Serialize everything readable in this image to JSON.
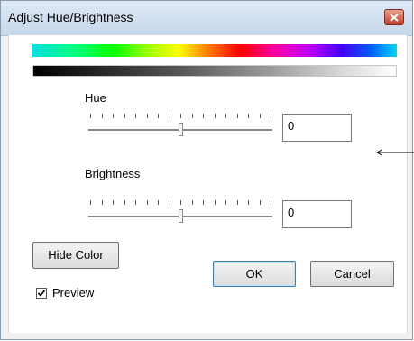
{
  "window": {
    "title": "Adjust Hue/Brightness"
  },
  "icons": {
    "close": "close-x-icon",
    "arrow": "arrow-left-icon",
    "check": "checkmark-icon"
  },
  "hue": {
    "label": "Hue",
    "value": "0",
    "level": 0.5
  },
  "brightness": {
    "label": "Brightness",
    "value": "0",
    "level": 0.5
  },
  "buttons": {
    "hide_color": "Hide Color",
    "ok": "OK",
    "cancel": "Cancel"
  },
  "preview": {
    "label": "Preview",
    "checked": true
  },
  "colors": {
    "title_gradient_top": "#dde8f4",
    "close_red": "#c4402a",
    "default_button_border": "#3c7fb1"
  }
}
